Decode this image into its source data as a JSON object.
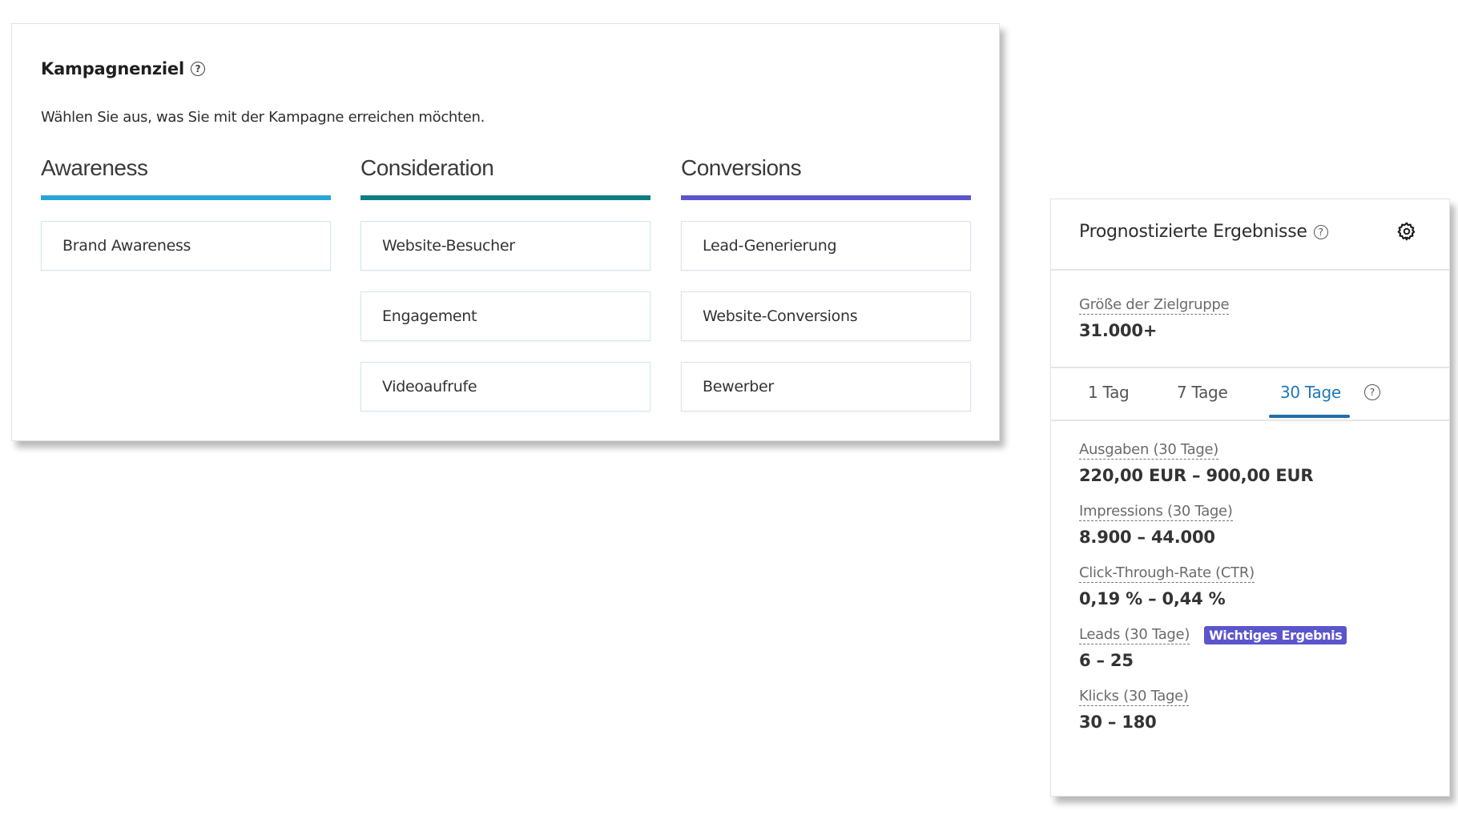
{
  "objective": {
    "title": "Kampagnenziel",
    "title_help_icon": "question-circle-icon",
    "subtitle": "Wählen Sie aus, was Sie mit der Kampagne erreichen möchten.",
    "columns": [
      {
        "heading": "Awareness",
        "accent_color": "#2aa3d8",
        "options": [
          "Brand Awareness"
        ]
      },
      {
        "heading": "Consideration",
        "accent_color": "#0d7e83",
        "options": [
          "Website-Besucher",
          "Engagement",
          "Videoaufrufe"
        ]
      },
      {
        "heading": "Conversions",
        "accent_color": "#5b55cd",
        "options": [
          "Lead-Generierung",
          "Website-Conversions",
          "Bewerber"
        ]
      }
    ]
  },
  "forecast": {
    "title": "Prognostizierte Ergebnisse",
    "title_help_icon": "question-circle-icon",
    "settings_icon": "gear-icon",
    "audience": {
      "label": "Größe der Zielgruppe",
      "value": "31.000+"
    },
    "tabs": [
      {
        "label": "1 Tag",
        "active": false
      },
      {
        "label": "7 Tage",
        "active": false
      },
      {
        "label": "30 Tage",
        "active": true
      }
    ],
    "tabs_help_icon": "question-circle-icon",
    "active_tab_color": "#1f78b8",
    "metrics": [
      {
        "label": "Ausgaben (30 Tage)",
        "value": "220,00 EUR – 900,00 EUR"
      },
      {
        "label": "Impressions (30 Tage)",
        "value": "8.900 – 44.000"
      },
      {
        "label": "Click-Through-Rate (CTR)",
        "value": "0,19 % – 0,44 %"
      },
      {
        "label": "Leads (30 Tage)",
        "value": "6 – 25",
        "badge": "Wichtiges Ergebnis"
      },
      {
        "label": "Klicks (30 Tage)",
        "value": "30 – 180"
      }
    ],
    "badge_color": "#5b55cd"
  }
}
